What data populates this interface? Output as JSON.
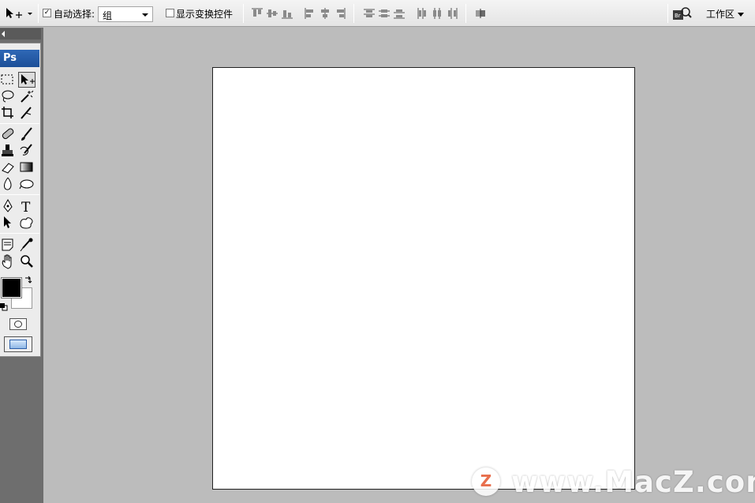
{
  "options_bar": {
    "tool_preset_icon": "move-tool-icon",
    "auto_select": {
      "label": "自动选择:",
      "checked": true
    },
    "auto_select_target": {
      "value": "组"
    },
    "show_transform_controls": {
      "label": "显示变换控件",
      "checked": false
    },
    "align_icons": [
      "align-top-edges-icon",
      "align-vertical-centers-icon",
      "align-bottom-edges-icon",
      "align-left-edges-icon",
      "align-horizontal-centers-icon",
      "align-right-edges-icon"
    ],
    "distribute_icons": [
      "distribute-top-icon",
      "distribute-vertical-centers-icon",
      "distribute-bottom-icon",
      "distribute-left-icon",
      "distribute-horizontal-centers-icon",
      "distribute-right-icon"
    ],
    "auto_align_icon": "auto-align-layers-icon",
    "bridge_icon": "bridge-icon",
    "workspace_label": "工作区"
  },
  "toolbox": {
    "logo": "Ps",
    "tools": [
      "rectangular-marquee-icon",
      "move-icon",
      "lasso-icon",
      "magic-wand-icon",
      "crop-icon",
      "slice-icon",
      "healing-brush-icon",
      "brush-icon",
      "clone-stamp-icon",
      "history-brush-icon",
      "eraser-icon",
      "gradient-icon",
      "blur-icon",
      "dodge-icon",
      "pen-icon",
      "type-icon",
      "path-selection-icon",
      "custom-shape-icon",
      "notes-icon",
      "eyedropper-icon",
      "hand-icon",
      "zoom-icon"
    ],
    "foreground_color": "#000000",
    "background_color": "#ffffff"
  },
  "watermark": {
    "logo_letter": "Z",
    "text": "www.MacZ.com",
    "accent": "#e4572e"
  }
}
